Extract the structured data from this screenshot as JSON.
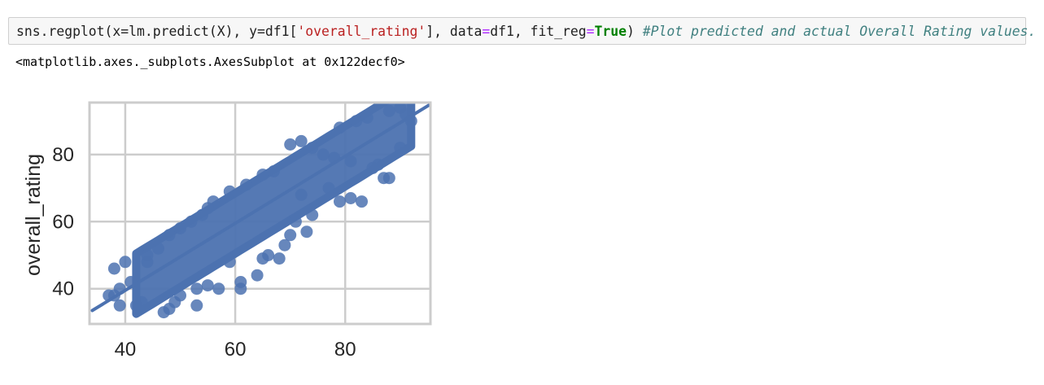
{
  "input_cell": {
    "code_a": "sns.regplot(x=lm.predict(X), y=df1[",
    "code_str": "'overall_rating'",
    "code_b": "], data",
    "code_eq1": "=",
    "code_c": "df1, fit_reg",
    "code_eq2": "=",
    "code_kw": "True",
    "code_d": ") ",
    "code_comment": "#Plot predicted and actual Overall Rating values."
  },
  "output": {
    "repr_text": "<matplotlib.axes._subplots.AxesSubplot at 0x122decf0>"
  },
  "chart_data": {
    "type": "scatter",
    "title": "",
    "xlabel": "",
    "ylabel": "overall_rating",
    "xlim": [
      33.5,
      95.5
    ],
    "ylim": [
      29.5,
      95.5
    ],
    "xticks": [
      40,
      60,
      80
    ],
    "yticks": [
      40,
      60,
      80
    ],
    "grid": true,
    "point_color": "#4c72b0",
    "regression_line": {
      "x": [
        34,
        96
      ],
      "y": [
        33.5,
        95.5
      ]
    },
    "trend_band": {
      "x_start": 42,
      "x_end": 92,
      "band_center_offset": 0,
      "band_half_width": 9
    },
    "points": [
      [
        37,
        38
      ],
      [
        38,
        38
      ],
      [
        39,
        40
      ],
      [
        39,
        35
      ],
      [
        40,
        48
      ],
      [
        38,
        46
      ],
      [
        41,
        42
      ],
      [
        42,
        35
      ],
      [
        43,
        36
      ],
      [
        44,
        48
      ],
      [
        47,
        33
      ],
      [
        48,
        34
      ],
      [
        49,
        36
      ],
      [
        50,
        38
      ],
      [
        53,
        35
      ],
      [
        53,
        40
      ],
      [
        55,
        41
      ],
      [
        57,
        40
      ],
      [
        61,
        40
      ],
      [
        61,
        42
      ],
      [
        64,
        44
      ],
      [
        59,
        48
      ],
      [
        66,
        50
      ],
      [
        68,
        49
      ],
      [
        65,
        49
      ],
      [
        69,
        53
      ],
      [
        70,
        56
      ],
      [
        73,
        57
      ],
      [
        71,
        60
      ],
      [
        74,
        62
      ],
      [
        79,
        66
      ],
      [
        81,
        67
      ],
      [
        83,
        66
      ],
      [
        87,
        73
      ],
      [
        88,
        73
      ],
      [
        86,
        77
      ],
      [
        81,
        78
      ],
      [
        78,
        79
      ],
      [
        76,
        80
      ],
      [
        74,
        82
      ],
      [
        67,
        75
      ],
      [
        65,
        74
      ],
      [
        62,
        71
      ],
      [
        59,
        69
      ],
      [
        56,
        66
      ],
      [
        55,
        64
      ],
      [
        54,
        62
      ],
      [
        52,
        60
      ],
      [
        50,
        58
      ],
      [
        48,
        56
      ],
      [
        46,
        52
      ],
      [
        44,
        50
      ],
      [
        70,
        83
      ],
      [
        72,
        84
      ],
      [
        79,
        88
      ],
      [
        82,
        90
      ],
      [
        84,
        91
      ],
      [
        88,
        93
      ],
      [
        90,
        94
      ],
      [
        91,
        92
      ],
      [
        92,
        90
      ],
      [
        90,
        82
      ],
      [
        85,
        76
      ],
      [
        77,
        70
      ],
      [
        72,
        68
      ]
    ]
  }
}
